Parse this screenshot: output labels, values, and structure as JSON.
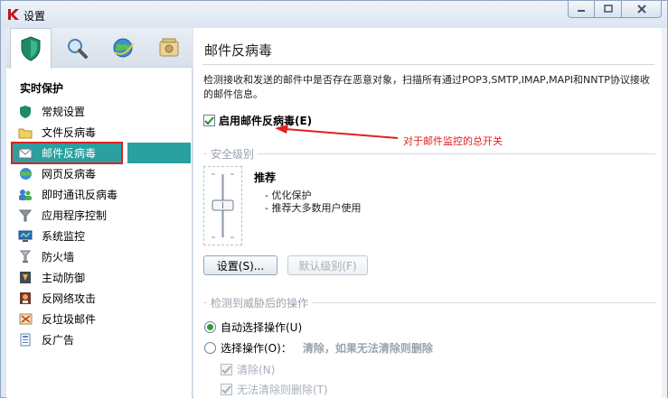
{
  "window": {
    "title": "设置",
    "minimize_label": "",
    "maximize_label": "",
    "close_label": ""
  },
  "sidebar": {
    "tabs": [
      {
        "name": "protection-tab",
        "icon": "shield-icon"
      },
      {
        "name": "scan-tab",
        "icon": "magnifier-icon"
      },
      {
        "name": "update-tab",
        "icon": "globe-icon"
      },
      {
        "name": "options-tab",
        "icon": "safe-box-icon"
      }
    ],
    "section_title": "实时保护",
    "items": [
      {
        "label": "常规设置",
        "icon": "general-settings-icon"
      },
      {
        "label": "文件反病毒",
        "icon": "folder-icon"
      },
      {
        "label": "邮件反病毒",
        "icon": "envelope-icon"
      },
      {
        "label": "网页反病毒",
        "icon": "globe-icon"
      },
      {
        "label": "即时通讯反病毒",
        "icon": "chat-users-icon"
      },
      {
        "label": "应用程序控制",
        "icon": "funnel-icon"
      },
      {
        "label": "系统监控",
        "icon": "system-monitor-icon"
      },
      {
        "label": "防火墙",
        "icon": "firewall-icon"
      },
      {
        "label": "主动防御",
        "icon": "proactive-defense-icon"
      },
      {
        "label": "反网络攻击",
        "icon": "network-attack-icon"
      },
      {
        "label": "反垃圾邮件",
        "icon": "antispam-icon"
      },
      {
        "label": "反广告",
        "icon": "antibanner-icon"
      }
    ],
    "selected_index": 2
  },
  "main": {
    "title": "邮件反病毒",
    "description": "检测接收和发送的邮件中是否存在恶意对象，扫描所有通过POP3,SMTP,IMAP,MAPI和NNTP协议接收的邮件信息。",
    "enable_label": "启用邮件反病毒(E)",
    "enable_checked": true,
    "annotation": "对于邮件监控的总开关",
    "security_level": {
      "group_label": "安全级别",
      "level_name": "推荐",
      "bullets": [
        "- 优化保护",
        "- 推荐大多数用户使用"
      ],
      "settings_button": "设置(S)...",
      "default_button": "默认级别(F)"
    },
    "action": {
      "group_label": "检测到威胁后的操作",
      "auto_label": "自动选择操作(U)",
      "auto_selected": true,
      "choose_label": "选择操作(O)：",
      "choose_hint": "清除，如果无法清除则删除",
      "disinfect_label": "清除(N)",
      "delete_label": "无法清除则删除(T)"
    }
  },
  "colors": {
    "selected_bg": "#2aa0a0",
    "highlight_red": "#e02020",
    "radio_green": "#2e9b3b"
  }
}
